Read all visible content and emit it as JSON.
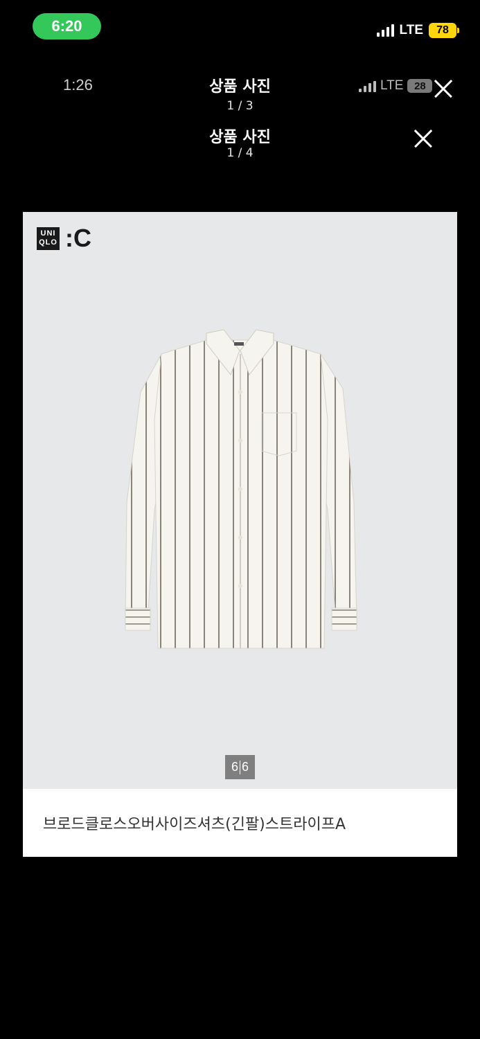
{
  "status_bar": {
    "time": "6:20",
    "network": "LTE",
    "battery": "78"
  },
  "captured_status": {
    "time": "1:26",
    "network": "LTE",
    "battery": "28"
  },
  "headers": [
    {
      "title": "상품 사진",
      "count": "1 / 3"
    },
    {
      "title": "상품 사진",
      "count": "1 / 4"
    }
  ],
  "product": {
    "brand_logo_text": "UNI QLO",
    "brand_suffix": ":C",
    "image_subject": "white oversized long-sleeve shirt with thin vertical stripes",
    "page_current": "6",
    "page_total": "6",
    "name": "브로드클로스오버사이즈셔츠(긴팔)스트라이프A"
  },
  "colors": {
    "background": "#000000",
    "time_pill": "#34c759",
    "battery": "#ffd60a",
    "photo_bg": "#e7e8ea"
  }
}
